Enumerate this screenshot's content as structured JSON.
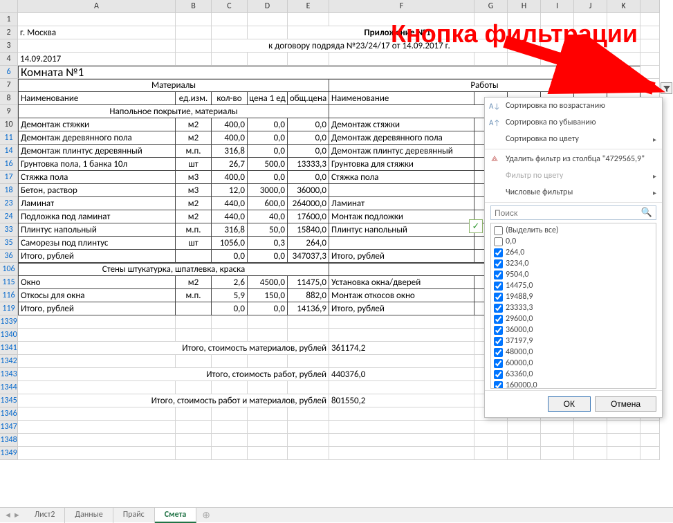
{
  "annotation": "Кнопка фильтрации",
  "columns": [
    "A",
    "B",
    "C",
    "D",
    "E",
    "F",
    "G",
    "H",
    "I",
    "J",
    "K"
  ],
  "rows_visible": [
    "1",
    "2",
    "3",
    "4",
    "6",
    "7",
    "8",
    "9",
    "10",
    "11",
    "14",
    "16",
    "17",
    "18",
    "23",
    "24",
    "33",
    "35",
    "36",
    "106",
    "115",
    "116",
    "119",
    "1339",
    "1340",
    "1341",
    "1342",
    "1343",
    "1344",
    "1345",
    "1346",
    "1347",
    "1348",
    "1349"
  ],
  "header": {
    "city": "г. Москва",
    "title": "Приложение №1",
    "subtitle": "к договору подряда №23/24/17 от 14.09.2017 г.",
    "date": "14.09.2017",
    "room": "Комната №1"
  },
  "table_headers": {
    "materials": "Материалы",
    "works": "Работы",
    "name": "Наименование",
    "unit": "ед.изм.",
    "qty": "кол-во",
    "price": "цена 1 ед",
    "total": "общ.цена"
  },
  "sections": {
    "floor": "Напольное покрытие, материалы",
    "walls": "Стены штукатурка, шпатлевка, краска"
  },
  "rows": [
    {
      "r": "10",
      "a": "Демонтаж стяжки",
      "b": "м2",
      "c": "400,0",
      "d": "0,0",
      "e": "0,0",
      "f": "Демонтаж стяжки"
    },
    {
      "r": "11",
      "a": "Демонтаж деревянного пола",
      "b": "м2",
      "c": "400,0",
      "d": "0,0",
      "e": "0,0",
      "f": "Демонтаж деревянного пола"
    },
    {
      "r": "14",
      "a": "Демонтаж плинтус деревянный",
      "b": "м.п.",
      "c": "316,8",
      "d": "0,0",
      "e": "0,0",
      "f": "Демонтаж плинтус деревянный"
    },
    {
      "r": "16",
      "a": "Грунтовка пола, 1 банка 10л",
      "b": "шт",
      "c": "26,7",
      "d": "500,0",
      "e": "13333,3",
      "f": "Грунтовка для стяжки"
    },
    {
      "r": "17",
      "a": "Стяжка пола",
      "b": "м3",
      "c": "400,0",
      "d": "0,0",
      "e": "0,0",
      "f": "Стяжка пола"
    },
    {
      "r": "18",
      "a": "Бетон, раствор",
      "b": "м3",
      "c": "12,0",
      "d": "3000,0",
      "e": "36000,0",
      "f": ""
    },
    {
      "r": "23",
      "a": "Ламинат",
      "b": "м2",
      "c": "440,0",
      "d": "600,0",
      "e": "264000,0",
      "f": "Ламинат"
    },
    {
      "r": "24",
      "a": "Подложка под ламинат",
      "b": "м2",
      "c": "440,0",
      "d": "40,0",
      "e": "17600,0",
      "f": "Монтаж подложки"
    },
    {
      "r": "33",
      "a": "Плинтус напольный",
      "b": "м.п.",
      "c": "316,8",
      "d": "50,0",
      "e": "15840,0",
      "f": "Плинтус напольный"
    },
    {
      "r": "35",
      "a": "Саморезы под плинтус",
      "b": "шт",
      "c": "1056,0",
      "d": "0,3",
      "e": "264,0",
      "f": ""
    },
    {
      "r": "36",
      "a": "Итого, рублей",
      "b": "",
      "c": "0,0",
      "d": "0,0",
      "e": "347037,3",
      "f": "Итого, рублей"
    },
    {
      "r": "115",
      "a": "Окно",
      "b": "м2",
      "c": "2,6",
      "d": "4500,0",
      "e": "11475,0",
      "f": "Установка окна/дверей"
    },
    {
      "r": "116",
      "a": "Откосы для окна",
      "b": "м.п.",
      "c": "5,9",
      "d": "150,0",
      "e": "882,0",
      "f": "Монтаж откосов окно"
    },
    {
      "r": "119",
      "a": "Итого, рублей",
      "b": "",
      "c": "0,0",
      "d": "0,0",
      "e": "14136,9",
      "f": "Итого, рублей"
    }
  ],
  "totals": [
    {
      "r": "1341",
      "label": "Итого, стоимость материалов, рублей",
      "value": "361174,2"
    },
    {
      "r": "1343",
      "label": "Итого, стоимость работ, рублей",
      "value": "440376,0"
    },
    {
      "r": "1345",
      "label": "Итого, стоимость работ и материалов, рублей",
      "value": "801550,2"
    }
  ],
  "filter_menu": {
    "sort_asc": "Сортировка по возрастанию",
    "sort_desc": "Сортировка по убыванию",
    "sort_color": "Сортировка по цвету",
    "clear_filter": "Удалить фильтр из столбца \"4729565,9\"",
    "filter_color": "Фильтр по цвету",
    "num_filters": "Числовые фильтры",
    "search_placeholder": "Поиск",
    "select_all": "(Выделить все)",
    "values": [
      "0,0",
      "264,0",
      "3234,0",
      "9504,0",
      "14475,0",
      "19488,9",
      "23333,3",
      "29600,0",
      "36000,0",
      "37197,9",
      "48000,0",
      "60000,0",
      "63360,0",
      "160000,0"
    ],
    "ok": "ОК",
    "cancel": "Отмена"
  },
  "tabs": [
    "Лист2",
    "Данные",
    "Прайс",
    "Смета"
  ],
  "active_tab": "Смета"
}
